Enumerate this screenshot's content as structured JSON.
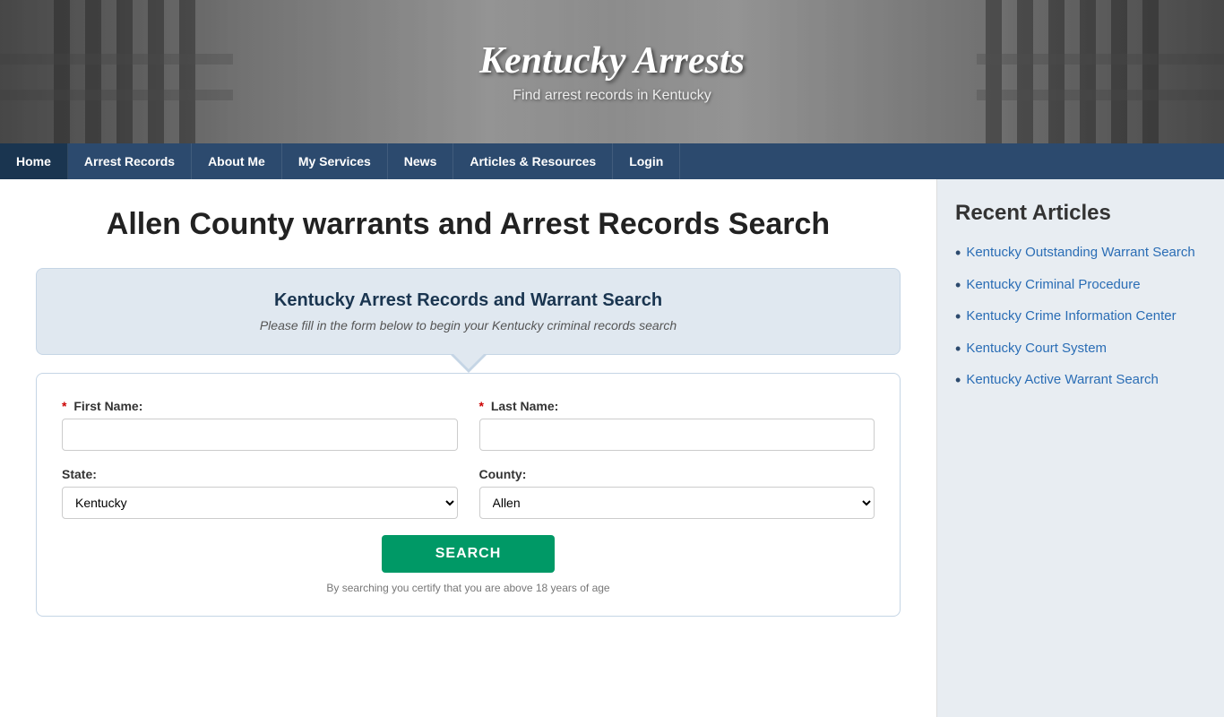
{
  "site": {
    "title": "Kentucky Arrests",
    "tagline": "Find arrest records in Kentucky"
  },
  "nav": {
    "items": [
      {
        "label": "Home",
        "id": "home"
      },
      {
        "label": "Arrest Records",
        "id": "arrest-records"
      },
      {
        "label": "About Me",
        "id": "about-me"
      },
      {
        "label": "My Services",
        "id": "my-services"
      },
      {
        "label": "News",
        "id": "news"
      },
      {
        "label": "Articles & Resources",
        "id": "articles-resources"
      },
      {
        "label": "Login",
        "id": "login"
      }
    ]
  },
  "main": {
    "page_title": "Allen County warrants and Arrest Records Search",
    "search_box": {
      "title": "Kentucky Arrest Records and Warrant Search",
      "subtitle": "Please fill in the form below to begin your Kentucky criminal records search",
      "first_name_label": "First Name:",
      "last_name_label": "Last Name:",
      "state_label": "State:",
      "county_label": "County:",
      "state_default": "Kentucky",
      "county_default": "Allen",
      "search_button": "SEARCH",
      "form_note": "By searching you certify that you are above 18 years of age"
    }
  },
  "sidebar": {
    "title": "Recent Articles",
    "articles": [
      {
        "label": "Kentucky Outstanding Warrant Search",
        "id": "ky-outstanding"
      },
      {
        "label": "Kentucky Criminal Procedure",
        "id": "ky-criminal-proc"
      },
      {
        "label": "Kentucky Crime Information Center",
        "id": "ky-crime-info"
      },
      {
        "label": "Kentucky Court System",
        "id": "ky-court"
      },
      {
        "label": "Kentucky Active Warrant Search",
        "id": "ky-active-warrant"
      }
    ]
  }
}
